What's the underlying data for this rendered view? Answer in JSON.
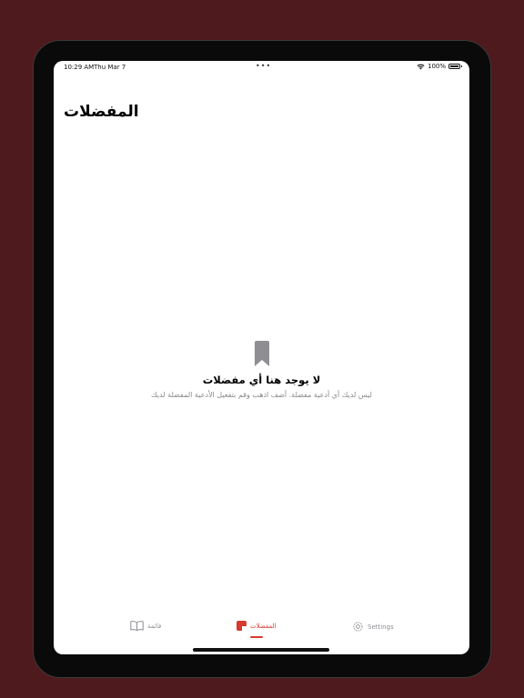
{
  "status": {
    "time": "10:29 AM",
    "date": "Thu Mar 7",
    "dots": "•••",
    "battery": "100%"
  },
  "page": {
    "title": "المفضلات"
  },
  "empty_state": {
    "icon": "bookmark-icon",
    "title": "لا يوجد هنا أي مفضلات",
    "subtitle": "ليس لديك أي أدعية مفضلة. أضف اذهب وقم بتفعيل الأدعية المفضلة لديك"
  },
  "tabs": [
    {
      "label": "قائمة",
      "icon": "book-icon",
      "active": false
    },
    {
      "label": "المفضلات",
      "icon": "bookmark-icon",
      "active": true
    },
    {
      "label": "Settings",
      "icon": "gear-icon",
      "active": false
    }
  ],
  "colors": {
    "background": "#4e1a1d",
    "accent": "#d63a2f",
    "bookmark_gray": "#8e8e93"
  }
}
